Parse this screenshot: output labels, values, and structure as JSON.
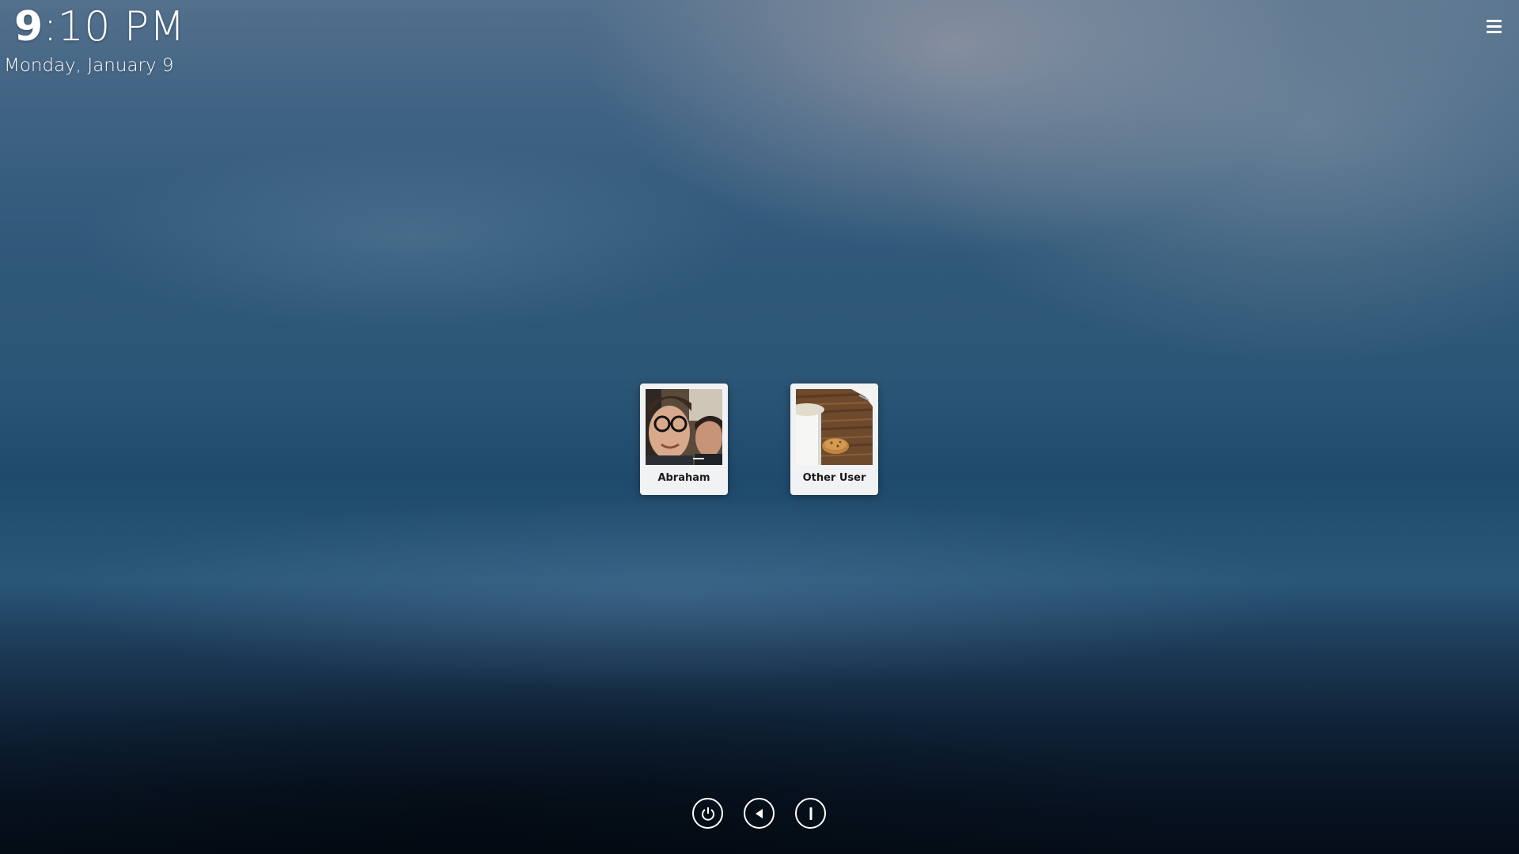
{
  "clock": {
    "hour": "9",
    "rest": ":10 PM"
  },
  "date": "Monday, January  9",
  "menu": {
    "icon": "hamburger-menu-icon"
  },
  "users": [
    {
      "name": "Abraham",
      "avatar": "selfie-photo"
    },
    {
      "name": "Other User",
      "avatar": "coffee-cookie-photo"
    }
  ],
  "bottom_buttons": [
    {
      "icon": "power-icon"
    },
    {
      "icon": "back-triangle-icon"
    },
    {
      "icon": "info-bar-icon"
    }
  ]
}
